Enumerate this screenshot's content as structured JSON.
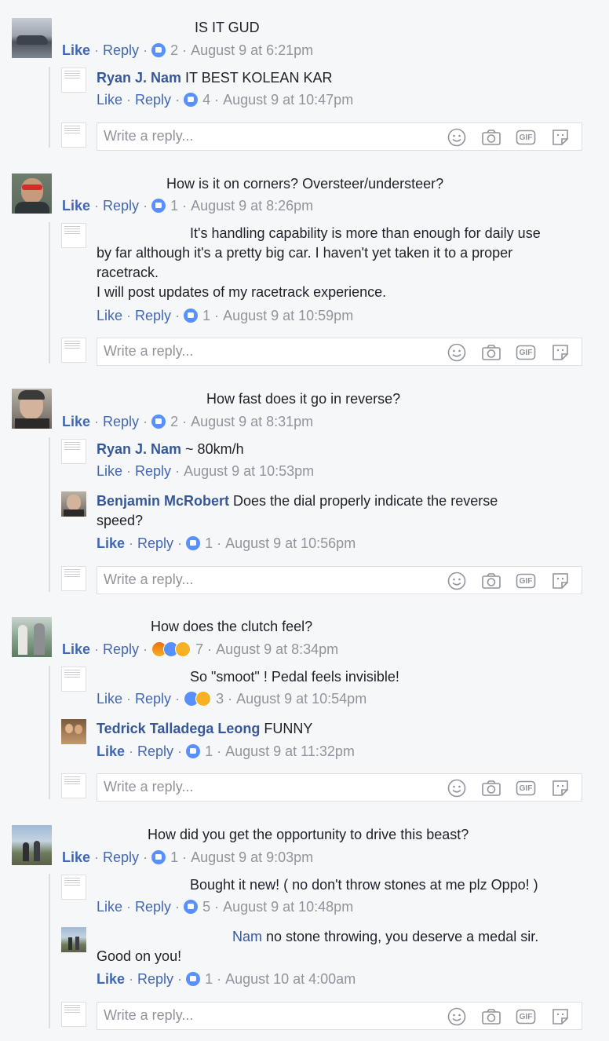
{
  "colors": {
    "link": "#4267b2",
    "name": "#365899",
    "meta": "#90949c",
    "like": "#5890ff"
  },
  "icons": [
    "emoji-icon",
    "camera-icon",
    "gif-icon",
    "sticker-icon",
    "like-reaction-icon"
  ],
  "reply_placeholder": "Write a reply...",
  "gif_label": "GIF",
  "meta_common": {
    "like": "Like",
    "reply": "Reply",
    "sep": "·"
  },
  "threads": [
    {
      "comment": {
        "text": "IS IT GUD",
        "count": "2",
        "time": "August 9 at 6:21pm"
      },
      "replies": [
        {
          "name": "Ryan J. Nam",
          "text": " IT BEST KOLEAN KAR",
          "count": "4",
          "time": "August 9 at 10:47pm"
        }
      ]
    },
    {
      "comment": {
        "text": "How is it on corners? Oversteer/understeer?",
        "count": "1",
        "time": "August 9 at 8:26pm"
      },
      "replies": [
        {
          "lines": [
            "It's handling capability is more than enough for daily use",
            "by far although it's a pretty big car. I haven't yet taken it to a proper",
            "racetrack.",
            "I will post updates of my racetrack experience."
          ],
          "count": "1",
          "time": "August 9 at 10:59pm"
        }
      ]
    },
    {
      "comment": {
        "text": "How fast does it go in reverse?",
        "count": "2",
        "time": "August 9 at 8:31pm"
      },
      "replies": [
        {
          "name": "Ryan J. Nam",
          "text": " ~ 80km/h",
          "time": "August 9 at 10:53pm"
        },
        {
          "name": "Benjamin McRobert",
          "text": " Does the dial properly indicate the reverse",
          "text2": "speed?",
          "count": "1",
          "time": "August 9 at 10:56pm"
        }
      ]
    },
    {
      "comment": {
        "text": "How does the clutch feel?",
        "count": "7",
        "time": "August 9 at 8:34pm"
      },
      "replies": [
        {
          "text": "So \"smoot\" ! Pedal feels invisible!",
          "count": "3",
          "time": "August 9 at 10:54pm"
        },
        {
          "name": "Tedrick Talladega Leong",
          "text": " FUNNY",
          "count": "1",
          "time": "August 9 at 11:32pm"
        }
      ]
    },
    {
      "comment": {
        "text": "How did you get the opportunity to drive this beast?",
        "count": "1",
        "time": "August 9 at 9:03pm"
      },
      "replies": [
        {
          "text": "Bought it new! ( no don't throw stones at me plz Oppo! )",
          "count": "5",
          "time": "August 9 at 10:48pm"
        },
        {
          "name": "Nam",
          "text": " no stone throwing, you deserve a medal sir.",
          "text2": "Good on you!",
          "count": "1",
          "time": "August 10 at 4:00am"
        }
      ]
    }
  ]
}
